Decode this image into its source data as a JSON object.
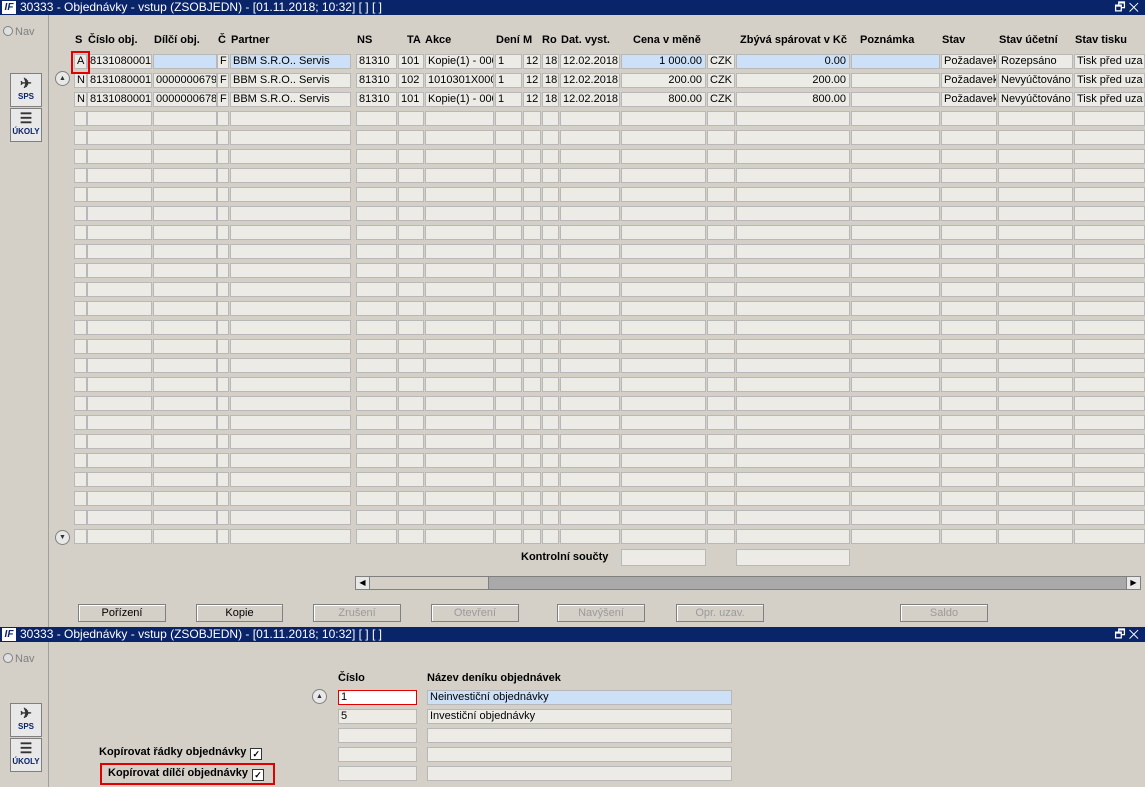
{
  "window1": {
    "title": "30333 - Objednávky - vstup (ZSOBJEDN) - [01.11.2018; 10:32]  [ ]  [ ]",
    "nav_label": "Nav",
    "tools": {
      "sps": "SPS",
      "ukoly": "ÚKOLY"
    },
    "window_buttons": "🗗✕",
    "columns": {
      "s": "S",
      "cislo": "Číslo obj.",
      "dilci": "Dílčí obj.",
      "c": "Č",
      "partner": "Partner",
      "ns": "NS",
      "ta": "TA",
      "akce": "Akce",
      "deni": "Dení",
      "m": "M",
      "ro": "Ro",
      "dat": "Dat. vyst.",
      "cena": "Cena v měně",
      "zbyva": "Zbývá spárovat v Kč",
      "poznamka": "Poznámka",
      "stav": "Stav",
      "stav_ucetni": "Stav účetní",
      "stav_tisku": "Stav tisku"
    },
    "rows": [
      {
        "s": "A",
        "cislo": "8131080001",
        "dilci": "",
        "c": "F",
        "partner": "BBM S.R.O.. Servis",
        "ns": "81310",
        "ta": "101",
        "akce": "Kopie(1) - 000",
        "deni": "1",
        "m": "12",
        "ro": "18",
        "dat": "12.02.2018",
        "cena": "1 000.00",
        "mena": "CZK",
        "zbyva": "0.00",
        "poznamka": "",
        "stav": "Požadavek",
        "stav_ucetni": "Rozepsáno",
        "stav_tisku": "Tisk před uza"
      },
      {
        "s": "N",
        "cislo": "8131080001",
        "dilci": "0000000679",
        "c": "F",
        "partner": "BBM S.R.O.. Servis",
        "ns": "81310",
        "ta": "102",
        "akce": "1010301X000",
        "deni": "1",
        "m": "12",
        "ro": "18",
        "dat": "12.02.2018",
        "cena": "200.00",
        "mena": "CZK",
        "zbyva": "200.00",
        "poznamka": "",
        "stav": "Požadavek",
        "stav_ucetni": "Nevyúčtováno",
        "stav_tisku": "Tisk před uza"
      },
      {
        "s": "N",
        "cislo": "8131080001",
        "dilci": "0000000678",
        "c": "F",
        "partner": "BBM S.R.O.. Servis",
        "ns": "81310",
        "ta": "101",
        "akce": "Kopie(1) - 000",
        "deni": "1",
        "m": "12",
        "ro": "18",
        "dat": "12.02.2018",
        "cena": "800.00",
        "mena": "CZK",
        "zbyva": "800.00",
        "poznamka": "",
        "stav": "Požadavek",
        "stav_ucetni": "Nevyúčtováno",
        "stav_tisku": "Tisk před uza"
      }
    ],
    "totals_label": "Kontrolní součty",
    "buttons": {
      "porizeni": "Pořízení",
      "kopie": "Kopie",
      "zruseni": "Zrušení",
      "otevreni": "Otevření",
      "navyseni": "Navýšení",
      "opr_uzav": "Opr. uzav.",
      "saldo": "Saldo"
    }
  },
  "window2": {
    "title": "30333 - Objednávky - vstup (ZSOBJEDN) - [01.11.2018; 10:32]  [ ]  [ ]",
    "nav_label": "Nav",
    "tools": {
      "sps": "SPS",
      "ukoly": "ÚKOLY"
    },
    "window_buttons": "🗗✕",
    "col_cislo": "Číslo",
    "col_nazev": "Název deníku objednávek",
    "rows": [
      {
        "cislo": "1",
        "nazev": "Neinvestiční objednávky"
      },
      {
        "cislo": "5",
        "nazev": "Investiční objednávky"
      }
    ],
    "copy_rows_label": "Kopírovat řádky objednávky",
    "copy_sub_label": "Kopírovat dílčí objednávky",
    "check_mark": "✓"
  }
}
